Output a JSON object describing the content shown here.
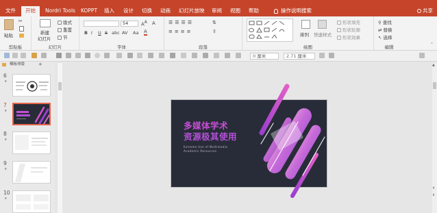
{
  "tabs": [
    "文件",
    "开始",
    "Nordri Tools",
    "KOPPT",
    "插入",
    "设计",
    "切换",
    "动画",
    "幻灯片放映",
    "审阅",
    "视图",
    "帮助"
  ],
  "active_tab": "开始",
  "tell_me": "操作说明搜索",
  "share": "共享",
  "ribbon": {
    "clipboard": {
      "paste": "粘贴",
      "label": "剪贴板"
    },
    "slides": {
      "new_slide": "新建",
      "new_slide2": "幻灯片",
      "layout": "版式",
      "reset": "重置",
      "section": "节",
      "label": "幻灯片"
    },
    "font": {
      "size": "54",
      "bold": "B",
      "italic": "I",
      "underline": "U",
      "strike": "S",
      "shadow": "abc",
      "spacing": "AV",
      "case": "Aa",
      "label": "字体"
    },
    "paragraph": {
      "label": "段落"
    },
    "drawing": {
      "arrange": "排列",
      "quick_styles": "快速样式",
      "fill": "形状填充",
      "outline": "形状轮廓",
      "effects": "形状效果",
      "label": "绘图"
    },
    "editing": {
      "find": "查找",
      "replace": "替换",
      "select": "选择",
      "label": "编辑"
    }
  },
  "qat": {
    "width": "0 厘米",
    "height": "2.71 厘米"
  },
  "thumb_panel": {
    "toolbar_text": "模板排版"
  },
  "thumbnails": [
    {
      "num": "6"
    },
    {
      "num": "7"
    },
    {
      "num": "8"
    },
    {
      "num": "9"
    },
    {
      "num": "10"
    }
  ],
  "selected_slide": "7",
  "slide": {
    "title_line1": "多媒体学术",
    "title_line2": "资源极其使用",
    "subtitle_line1": "Extreme Use of Multimedia",
    "subtitle_line2": "Academic Resources"
  },
  "colors": {
    "accent": "#c5442a",
    "slide_bg": "#282c38",
    "title_pink": "#c64fd5",
    "purple": "#9b3fcf"
  }
}
